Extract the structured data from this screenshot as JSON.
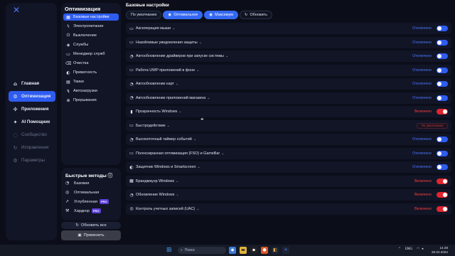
{
  "nav": {
    "items": [
      {
        "label": "Главная",
        "icon": "home-icon",
        "glyph": "⌂"
      },
      {
        "label": "Оптимизация",
        "icon": "optimize-icon",
        "glyph": "⚙"
      },
      {
        "label": "Приложения",
        "icon": "apps-icon",
        "glyph": "✣"
      },
      {
        "label": "AI Помощник",
        "icon": "ai-icon",
        "glyph": "✦"
      },
      {
        "label": "Сообщество",
        "icon": "community-icon",
        "glyph": "◌"
      },
      {
        "label": "Исправления",
        "icon": "fixes-icon",
        "glyph": "↻"
      },
      {
        "label": "Параметры",
        "icon": "settings-icon",
        "glyph": "⚙"
      }
    ]
  },
  "submenu": {
    "title": "Оптимизация",
    "items": [
      {
        "label": "Базовые настройки",
        "glyph": "▦"
      },
      {
        "label": "Электропитание",
        "glyph": "ϟ"
      },
      {
        "label": "Выключение",
        "glyph": "⏻"
      },
      {
        "label": "Службы",
        "glyph": "◈"
      },
      {
        "label": "Менеджер служб",
        "glyph": "▭"
      },
      {
        "label": "Очистка",
        "glyph": "⌫"
      },
      {
        "label": "Приватность",
        "glyph": "◐"
      },
      {
        "label": "Твики",
        "glyph": "▤"
      },
      {
        "label": "Автозагрузки",
        "glyph": "↯"
      },
      {
        "label": "Прерывания",
        "glyph": "⊕"
      }
    ]
  },
  "quick": {
    "title": "Быстрые методы",
    "info": "ⓘ",
    "items": [
      {
        "label": "Базовая",
        "glyph": "◔",
        "pro": ""
      },
      {
        "label": "Оптимальная",
        "glyph": "◎",
        "pro": ""
      },
      {
        "label": "Углубленная",
        "glyph": "↗",
        "pro": "PRO"
      },
      {
        "label": "Хардкор",
        "glyph": "⚒",
        "pro": "PRO"
      }
    ],
    "refresh_all": "Обновить все",
    "apply": "Применить"
  },
  "main": {
    "title": "Базовые настройки",
    "presets": [
      {
        "label": "По умолчанию",
        "glyph": ""
      },
      {
        "label": "Оптимальное",
        "glyph": "◉"
      },
      {
        "label": "Максимум",
        "glyph": "◉"
      },
      {
        "label": "Обновить",
        "glyph": "↻"
      }
    ],
    "rows": [
      {
        "label": "Акселерация мыши",
        "status": "Отключено",
        "state": "off",
        "glyph": "▭"
      },
      {
        "label": "Назойливые уведомления защиты",
        "status": "Отключено",
        "state": "off",
        "glyph": "▭"
      },
      {
        "label": "Автообновление драйверов при запуске системы",
        "status": "Отключено",
        "state": "off",
        "glyph": "◔"
      },
      {
        "label": "Работа UWP приложений в фоне",
        "status": "Отключено",
        "state": "off",
        "glyph": "▭"
      },
      {
        "label": "Автообновление карт",
        "status": "Отключено",
        "state": "off",
        "glyph": "◔"
      },
      {
        "label": "Автообновление приложений магазина",
        "status": "Отключено",
        "state": "off",
        "glyph": "◔"
      },
      {
        "label": "Прозрачность Windows",
        "status": "Включено",
        "state": "on",
        "glyph": "▮"
      },
      {
        "label": "Быстродействие",
        "status": "По умолчанию",
        "state": "select",
        "glyph": "▭"
      },
      {
        "label": "Высокоточный таймер событий",
        "status": "Отключено",
        "state": "off",
        "glyph": "◔"
      },
      {
        "label": "Полноэкранная оптимизация (FSO) и GameBar",
        "status": "Отключено",
        "state": "off",
        "glyph": "▭"
      },
      {
        "label": "Защитник Windows и Smartscreen",
        "status": "Отключено",
        "state": "off",
        "glyph": "◐"
      },
      {
        "label": "Брандмауэр Windows",
        "status": "Включено",
        "state": "on",
        "glyph": "▦"
      },
      {
        "label": "Обновление Windows",
        "status": "Включено",
        "state": "on",
        "glyph": "◔"
      },
      {
        "label": "Контроль учетных записей (UAC)",
        "status": "Включено",
        "state": "on",
        "glyph": "◎"
      }
    ]
  },
  "taskbar": {
    "search_placeholder": "Поиск",
    "lang": "ENG",
    "time": "14:28",
    "date": "26.02.2024"
  },
  "colors": {
    "accent": "#2f5cf0",
    "on_red": "#e1252e",
    "background": "#0b0e19",
    "panel": "#111526"
  }
}
